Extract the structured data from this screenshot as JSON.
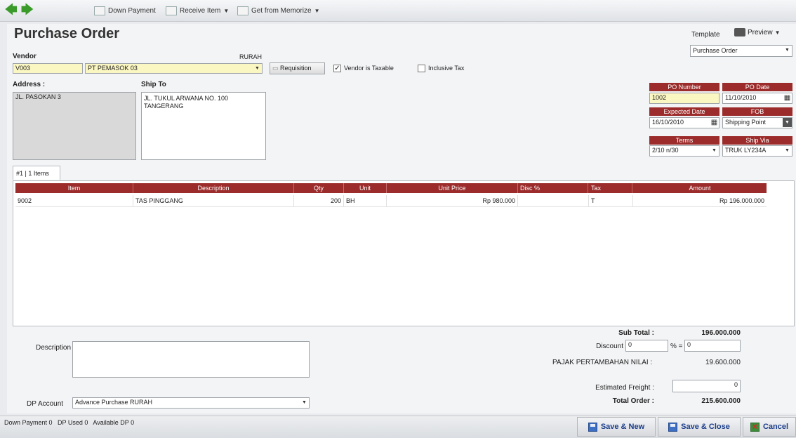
{
  "toolbar": {
    "down_payment": "Down Payment",
    "receive_item": "Receive Item",
    "get_from_memorize": "Get from Memorize"
  },
  "form": {
    "title": "Purchase Order"
  },
  "template": {
    "label": "Template",
    "preview": "Preview",
    "value": "Purchase Order"
  },
  "vendor": {
    "label": "Vendor",
    "code": "V003",
    "name": "PT PEMASOK 03",
    "branch": "RURAH",
    "requisition": "Requisition",
    "taxable_label": "Vendor is Taxable",
    "inclusive_label": "Inclusive Tax"
  },
  "address": {
    "label": "Address :",
    "value": "JL. PASOKAN 3"
  },
  "ship_to": {
    "label": "Ship To",
    "line1": "JL. TUKUL ARWANA NO. 100",
    "line2": "TANGERANG"
  },
  "po": {
    "number_label": "PO Number",
    "number": "1002",
    "date_label": "PO Date",
    "date": "11/10/2010",
    "expected_label": "Expected Date",
    "expected": "16/10/2010",
    "fob_label": "FOB",
    "fob": "Shipping Point",
    "terms_label": "Terms",
    "terms": "2/10 n/30",
    "ship_via_label": "Ship Via",
    "ship_via": "TRUK LY234A"
  },
  "tab": {
    "label": "#1 | 1 Items"
  },
  "grid": {
    "columns": [
      "Item",
      "Description",
      "Qty",
      "Unit",
      "Unit Price",
      "Disc %",
      "Tax",
      "Amount"
    ],
    "rows": [
      {
        "item": "9002",
        "description": "TAS PINGGANG",
        "qty": "200",
        "unit": "BH",
        "unit_price": "Rp 980.000",
        "disc": "",
        "tax": "T",
        "amount": "Rp 196.000.000"
      }
    ]
  },
  "footer": {
    "description_label": "Description",
    "dp_account_label": "DP Account",
    "dp_account_value": "Advance Purchase RURAH",
    "subtotal_label": "Sub Total :",
    "subtotal": "196.000.000",
    "discount_label": "Discount",
    "discount_pct": "0",
    "discount_sep": "% =",
    "discount_amt": "0",
    "tax_label": "PAJAK PERTAMBAHAN NILAI :",
    "tax_value": "19.600.000",
    "freight_label": "Estimated Freight :",
    "freight_value": "0",
    "total_label": "Total Order :",
    "total_value": "215.600.000"
  },
  "status": {
    "text": "Down Payment 0   DP Used 0   Available DP 0"
  },
  "buttons": {
    "save_new": "Save & New",
    "save_close": "Save & Close",
    "cancel": "Cancel"
  },
  "colors": {
    "header_red": "#9b2c2b",
    "field_yellow": "#fbf7c2"
  }
}
